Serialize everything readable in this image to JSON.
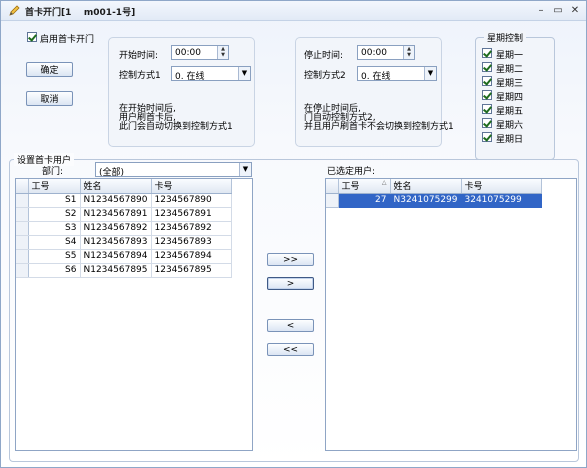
{
  "window": {
    "title": "首卡开门[1    m001-1号]",
    "minimize": "–",
    "maximize": "▭",
    "close": "✕"
  },
  "enable": {
    "label": "启用首卡开门",
    "checked": true
  },
  "buttons": {
    "ok": "确定",
    "cancel": "取消"
  },
  "start": {
    "time_label": "开始时间:",
    "time_value": "00:00",
    "mode_label": "控制方式1",
    "mode_value": "0.  在线",
    "desc": [
      "在开始时间后,",
      "用户刷首卡后,",
      "此门会自动切换到控制方式1"
    ]
  },
  "stop": {
    "time_label": "停止时间:",
    "time_value": "00:00",
    "mode_label": "控制方式2",
    "mode_value": "0.  在线",
    "desc": [
      "在停止时间后,",
      "门自动控制方式2,",
      "并且用户刷首卡不会切换到控制方式1"
    ]
  },
  "weekdays": {
    "title": "星期控制",
    "days": [
      {
        "label": "星期一",
        "checked": true
      },
      {
        "label": "星期二",
        "checked": true
      },
      {
        "label": "星期三",
        "checked": true
      },
      {
        "label": "星期四",
        "checked": true
      },
      {
        "label": "星期五",
        "checked": true
      },
      {
        "label": "星期六",
        "checked": true
      },
      {
        "label": "星期日",
        "checked": true
      }
    ]
  },
  "users": {
    "section_title": "设置首卡用户",
    "dept_label": "部门:",
    "dept_value": "(全部)",
    "columns": [
      "工号",
      "姓名",
      "卡号"
    ],
    "rows": [
      [
        "S1",
        "N1234567890",
        "1234567890"
      ],
      [
        "S2",
        "N1234567891",
        "1234567891"
      ],
      [
        "S3",
        "N1234567892",
        "1234567892"
      ],
      [
        "S4",
        "N1234567893",
        "1234567893"
      ],
      [
        "S5",
        "N1234567894",
        "1234567894"
      ],
      [
        "S6",
        "N1234567895",
        "1234567895"
      ]
    ]
  },
  "transfer": {
    "add_all": ">>",
    "add": ">",
    "remove": "<",
    "remove_all": "<<"
  },
  "selected": {
    "title": "已选定用户:",
    "columns": [
      "工号",
      "姓名",
      "卡号"
    ],
    "rows": [
      [
        "27",
        "N3241075299",
        "3241075299"
      ]
    ]
  }
}
